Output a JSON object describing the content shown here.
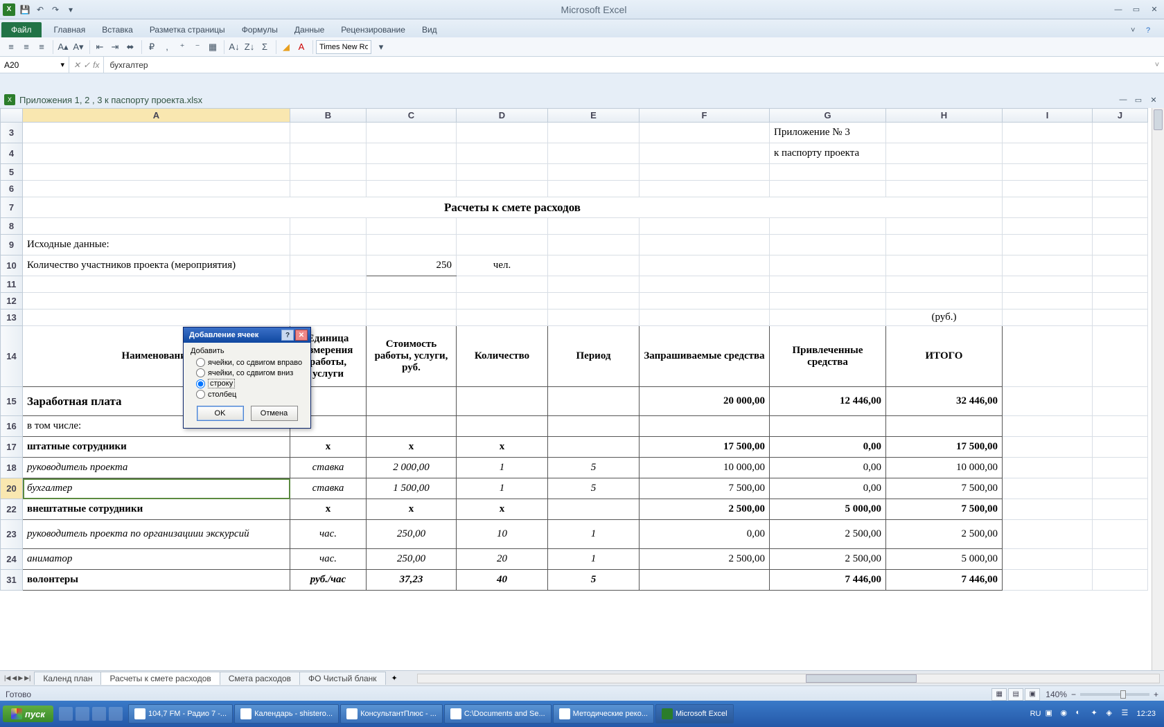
{
  "app": {
    "title": "Microsoft Excel"
  },
  "ribbon": {
    "file": "Файл",
    "tabs": [
      "Главная",
      "Вставка",
      "Разметка страницы",
      "Формулы",
      "Данные",
      "Рецензирование",
      "Вид"
    ],
    "font_name": "Times New Ro"
  },
  "namebox": "A20",
  "formula": "бухгалтер",
  "workbook": {
    "title": "Приложения 1, 2 , 3 к паспорту проекта.xlsx"
  },
  "columns": [
    "A",
    "B",
    "C",
    "D",
    "E",
    "F",
    "G",
    "H",
    "I",
    "J"
  ],
  "rows_visible": [
    "3",
    "4",
    "5",
    "6",
    "7",
    "8",
    "9",
    "10",
    "11",
    "12",
    "13",
    "14",
    "15",
    "16",
    "17",
    "18",
    "20",
    "22",
    "23",
    "24",
    "31"
  ],
  "cells": {
    "G3": "Приложение № 3",
    "G4": "к паспорту проекта",
    "A7_merge": "Расчеты к смете расходов",
    "A9": "Исходные данные:",
    "A10": "Количество участников проекта (мероприятия)",
    "C10": "250",
    "D10": "чел.",
    "H13": "(руб.)",
    "hdr": {
      "A": "Наименование",
      "B": "Единица измерения работы, услуги",
      "C": "Стоимость работы, услуги, руб.",
      "D": "Количество",
      "E": "Период",
      "F": "Запрашиваемые средства",
      "G": "Привлеченные средства",
      "H": "ИТОГО"
    },
    "r15": {
      "A": "Заработная плата",
      "F": "20 000,00",
      "G": "12 446,00",
      "H": "32 446,00"
    },
    "r16": {
      "A": "в том числе:"
    },
    "r17": {
      "A": "штатные сотрудники",
      "B": "x",
      "C": "x",
      "D": "x",
      "F": "17 500,00",
      "G": "0,00",
      "H": "17 500,00"
    },
    "r18": {
      "A": "руководитель проекта",
      "B": "ставка",
      "C": "2 000,00",
      "D": "1",
      "E": "5",
      "F": "10 000,00",
      "G": "0,00",
      "H": "10 000,00"
    },
    "r20": {
      "A": "бухгалтер",
      "B": "ставка",
      "C": "1 500,00",
      "D": "1",
      "E": "5",
      "F": "7 500,00",
      "G": "0,00",
      "H": "7 500,00"
    },
    "r22": {
      "A": "внештатные сотрудники",
      "B": "x",
      "C": "x",
      "D": "x",
      "F": "2 500,00",
      "G": "5 000,00",
      "H": "7 500,00"
    },
    "r23": {
      "A": "руководитель проекта по организациии экскурсий",
      "B": "час.",
      "C": "250,00",
      "D": "10",
      "E": "1",
      "F": "0,00",
      "G": "2 500,00",
      "H": "2 500,00"
    },
    "r24": {
      "A": "аниматор",
      "B": "час.",
      "C": "250,00",
      "D": "20",
      "E": "1",
      "F": "2 500,00",
      "G": "2 500,00",
      "H": "5 000,00"
    },
    "r31": {
      "A": "волонтеры",
      "B": "руб./час",
      "C": "37,23",
      "D": "40",
      "E": "5",
      "G": "7 446,00",
      "H": "7 446,00"
    }
  },
  "sheet_tabs": [
    "Календ план",
    "Расчеты к смете расходов",
    "Смета расходов",
    "ФО Чистый бланк"
  ],
  "active_sheet": 1,
  "status": {
    "ready": "Готово",
    "zoom": "140%"
  },
  "dialog": {
    "title": "Добавление ячеек",
    "label": "Добавить",
    "opts": [
      "ячейки, со сдвигом вправо",
      "ячейки, со сдвигом вниз",
      "строку",
      "столбец"
    ],
    "selected": 2,
    "ok": "OK",
    "cancel": "Отмена"
  },
  "taskbar": {
    "start": "пуск",
    "tasks": [
      "104,7 FM - Радио 7 -...",
      "Календарь - shistero...",
      "КонсультантПлюс - ...",
      "C:\\Documents and Se...",
      "Методические реко...",
      "Microsoft Excel"
    ],
    "lang": "RU",
    "time": "12:23"
  }
}
